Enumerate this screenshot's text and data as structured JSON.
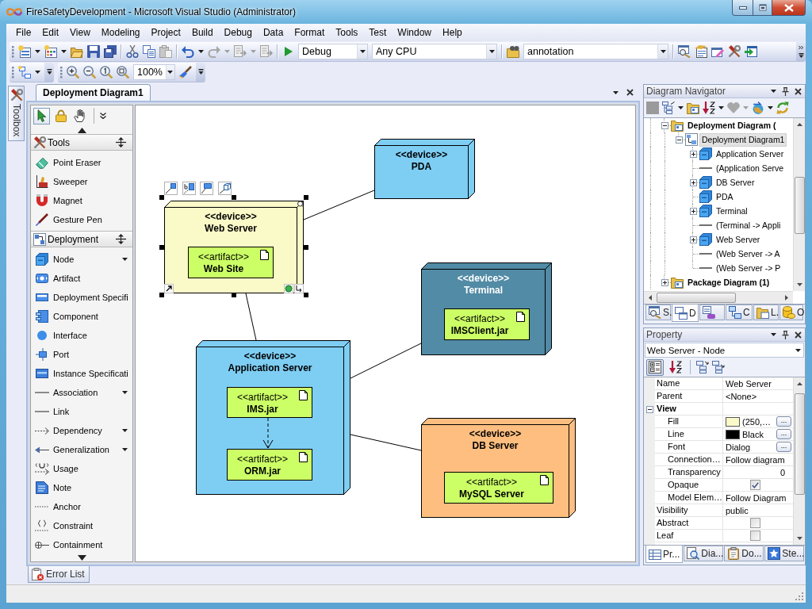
{
  "window": {
    "title": "FireSafetyDevelopment - Microsoft Visual Studio (Administrator)"
  },
  "menu": [
    "File",
    "Edit",
    "View",
    "Modeling",
    "Project",
    "Build",
    "Debug",
    "Data",
    "Format",
    "Tools",
    "Test",
    "Window",
    "Help"
  ],
  "standard_toolbar": {
    "configuration": "Debug",
    "platform": "Any CPU",
    "find": "annotation"
  },
  "zoom_toolbar": {
    "zoom": "100%"
  },
  "side_tabs": [
    {
      "label": "Toolbox"
    }
  ],
  "document_tabs": [
    {
      "label": "Deployment Diagram1",
      "selected": true
    }
  ],
  "toolbox": {
    "modes": [
      {
        "selected": true
      },
      {
        "selected": false
      },
      {
        "selected": false
      }
    ],
    "groups": [
      {
        "title": "Tools",
        "items": [
          {
            "label": "Point Eraser",
            "submenu": false
          },
          {
            "label": "Sweeper",
            "submenu": false
          },
          {
            "label": "Magnet",
            "submenu": false
          },
          {
            "label": "Gesture Pen",
            "submenu": false
          }
        ]
      },
      {
        "title": "Deployment",
        "items": [
          {
            "label": "Node",
            "submenu": true
          },
          {
            "label": "Artifact",
            "submenu": false
          },
          {
            "label": "Deployment Specifi",
            "submenu": false
          },
          {
            "label": "Component",
            "submenu": false
          },
          {
            "label": "Interface",
            "submenu": false
          },
          {
            "label": "Port",
            "submenu": false
          },
          {
            "label": "Instance Specificati",
            "submenu": false
          },
          {
            "label": "Association",
            "submenu": true
          },
          {
            "label": "Link",
            "submenu": false
          },
          {
            "label": "Dependency",
            "submenu": true
          },
          {
            "label": "Generalization",
            "submenu": true
          },
          {
            "label": "Usage",
            "submenu": false
          },
          {
            "label": "Note",
            "submenu": false
          },
          {
            "label": "Anchor",
            "submenu": false
          },
          {
            "label": "Constraint",
            "submenu": false
          },
          {
            "label": "Containment",
            "submenu": false
          }
        ]
      }
    ]
  },
  "diagram": {
    "nodes": [
      {
        "stereotype": "<<device>>",
        "name": "PDA",
        "color": "#7ecef4",
        "selected": false
      },
      {
        "stereotype": "<<device>>",
        "name": "Web Server",
        "color": "#faf9c8",
        "selected": true,
        "artifacts": [
          {
            "stereotype": "<<artifact>>",
            "name": "Web Site"
          }
        ]
      },
      {
        "stereotype": "<<device>>",
        "name": "Terminal",
        "color": "#528ba5",
        "selected": false,
        "artifacts": [
          {
            "stereotype": "<<artifact>>",
            "name": "IMSClient.jar"
          }
        ]
      },
      {
        "stereotype": "<<device>>",
        "name": "Application Server",
        "color": "#7ecef4",
        "selected": false,
        "artifacts": [
          {
            "stereotype": "<<artifact>>",
            "name": "IMS.jar"
          },
          {
            "stereotype": "<<artifact>>",
            "name": "ORM.jar"
          }
        ]
      },
      {
        "stereotype": "<<device>>",
        "name": "DB Server",
        "color": "#fdbe80",
        "selected": false,
        "artifacts": [
          {
            "stereotype": "<<artifact>>",
            "name": "MySQL Server"
          }
        ]
      }
    ]
  },
  "navigator": {
    "title": "Diagram Navigator",
    "tree": [
      {
        "label": "Deployment Diagram (",
        "kind": "folder",
        "expanded": true,
        "selected": false,
        "children": [
          {
            "label": "Deployment Diagram1",
            "kind": "diagram",
            "expanded": true,
            "selected": true,
            "children": [
              {
                "label": "Application Server",
                "kind": "node",
                "expanded": false,
                "selected": false
              },
              {
                "label": "(Application Serve",
                "kind": "connector",
                "selected": false
              },
              {
                "label": "DB Server",
                "kind": "node",
                "expanded": false,
                "selected": false
              },
              {
                "label": "PDA",
                "kind": "node",
                "selected": false
              },
              {
                "label": "Terminal",
                "kind": "node",
                "expanded": false,
                "selected": false
              },
              {
                "label": "(Terminal -> Appli",
                "kind": "connector",
                "selected": false
              },
              {
                "label": "Web Server",
                "kind": "node",
                "expanded": false,
                "selected": false
              },
              {
                "label": "(Web Server -> A",
                "kind": "connector",
                "selected": false
              },
              {
                "label": "(Web Server -> P",
                "kind": "connector",
                "selected": false
              }
            ]
          }
        ]
      },
      {
        "label": "Package Diagram (1)",
        "kind": "folder",
        "expanded": false,
        "selected": false
      }
    ],
    "tabs": [
      {
        "label": "S.",
        "selected": false
      },
      {
        "label": "D",
        "selected": true
      },
      {
        "selected": false
      },
      {
        "label": "C",
        "selected": false
      },
      {
        "label": "L.",
        "selected": false
      },
      {
        "label": "O",
        "selected": false
      }
    ]
  },
  "properties": {
    "title": "Property",
    "object": "Web Server - Node",
    "sort_modes": [
      {
        "selected": true
      },
      {
        "selected": false
      }
    ],
    "rows": [
      {
        "kind": "text",
        "name": "Name",
        "value": "Web Server"
      },
      {
        "kind": "text",
        "name": "Parent",
        "value": "<None>"
      },
      {
        "kind": "category",
        "name": "View",
        "expanded": true,
        "children": [
          {
            "kind": "color",
            "name": "Fill",
            "value": "(250,…",
            "color": "#faf9c8",
            "button": "..."
          },
          {
            "kind": "color",
            "name": "Line",
            "value": "Black",
            "color": "#000000",
            "button": "..."
          },
          {
            "kind": "text",
            "name": "Font",
            "value": "Dialog",
            "button": "..."
          },
          {
            "kind": "text",
            "name": "Connection…",
            "value": "Follow diagram"
          },
          {
            "kind": "number",
            "name": "Transparency",
            "value": "0"
          },
          {
            "kind": "checkbox",
            "name": "Opaque",
            "checked": true
          },
          {
            "kind": "text",
            "name": "Model Elem…",
            "value": "Follow Diagram"
          }
        ]
      },
      {
        "kind": "text",
        "name": "Visibility",
        "value": "public"
      },
      {
        "kind": "checkbox",
        "name": "Abstract",
        "checked": false
      },
      {
        "kind": "checkbox",
        "name": "Leaf",
        "checked": false
      }
    ],
    "tabs": [
      {
        "label": "Pr...",
        "selected": true
      },
      {
        "label": "Dia...",
        "selected": false
      },
      {
        "label": "Do...",
        "selected": false
      },
      {
        "label": "Ste...",
        "selected": false
      }
    ]
  },
  "bottom_tabs": [
    {
      "label": "Error List"
    }
  ]
}
